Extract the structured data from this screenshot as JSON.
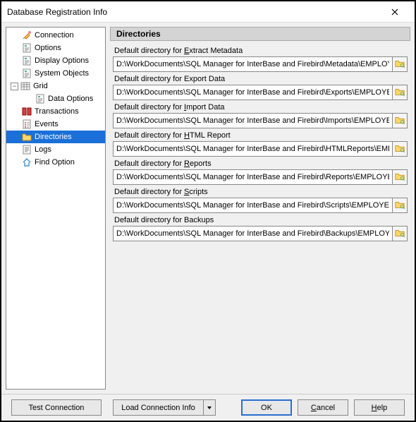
{
  "window": {
    "title": "Database Registration Info"
  },
  "sidebar": {
    "items": [
      {
        "label": "Connection",
        "icon": "plug"
      },
      {
        "label": "Options",
        "icon": "doc"
      },
      {
        "label": "Display Options",
        "icon": "doc"
      },
      {
        "label": "System Objects",
        "icon": "doc"
      }
    ],
    "grid": {
      "label": "Grid",
      "children": [
        {
          "label": "Data Options",
          "icon": "doc"
        }
      ]
    },
    "items2": [
      {
        "label": "Transactions",
        "icon": "transactions"
      },
      {
        "label": "Events",
        "icon": "events"
      },
      {
        "label": "Directories",
        "icon": "folder",
        "selected": true
      },
      {
        "label": "Logs",
        "icon": "doc"
      },
      {
        "label": "Find Option",
        "icon": "find"
      }
    ]
  },
  "panel": {
    "title": "Directories"
  },
  "fields": [
    {
      "label_pre": "Default directory for ",
      "mnemonic": "E",
      "label_post": "xtract Metadata",
      "value": "D:\\WorkDocuments\\SQL Manager for InterBase and Firebird\\Metadata\\EMPLOY"
    },
    {
      "label_pre": "Default directory for ",
      "mnemonic": "",
      "label_post": "Export Data",
      "value": "D:\\WorkDocuments\\SQL Manager for InterBase and Firebird\\Exports\\EMPLOYE"
    },
    {
      "label_pre": "Default directory for ",
      "mnemonic": "I",
      "label_post": "mport Data",
      "value": "D:\\WorkDocuments\\SQL Manager for InterBase and Firebird\\Imports\\EMPLOYE"
    },
    {
      "label_pre": "Default directory for ",
      "mnemonic": "H",
      "label_post": "TML Report",
      "value": "D:\\WorkDocuments\\SQL Manager for InterBase and Firebird\\HTMLReports\\EMF"
    },
    {
      "label_pre": "Default directory for ",
      "mnemonic": "R",
      "label_post": "eports",
      "value": "D:\\WorkDocuments\\SQL Manager for InterBase and Firebird\\Reports\\EMPLOYE"
    },
    {
      "label_pre": "Default directory for ",
      "mnemonic": "S",
      "label_post": "cripts",
      "value": "D:\\WorkDocuments\\SQL Manager for InterBase and Firebird\\Scripts\\EMPLOYEI"
    },
    {
      "label_pre": "Default directory for ",
      "mnemonic": "",
      "label_post": "Backups",
      "value": "D:\\WorkDocuments\\SQL Manager for InterBase and Firebird\\Backups\\EMPLOY"
    }
  ],
  "buttons": {
    "test": "Test Connection",
    "load": "Load Connection Info",
    "ok": "OK",
    "cancel": "Cancel",
    "help": "Help"
  }
}
